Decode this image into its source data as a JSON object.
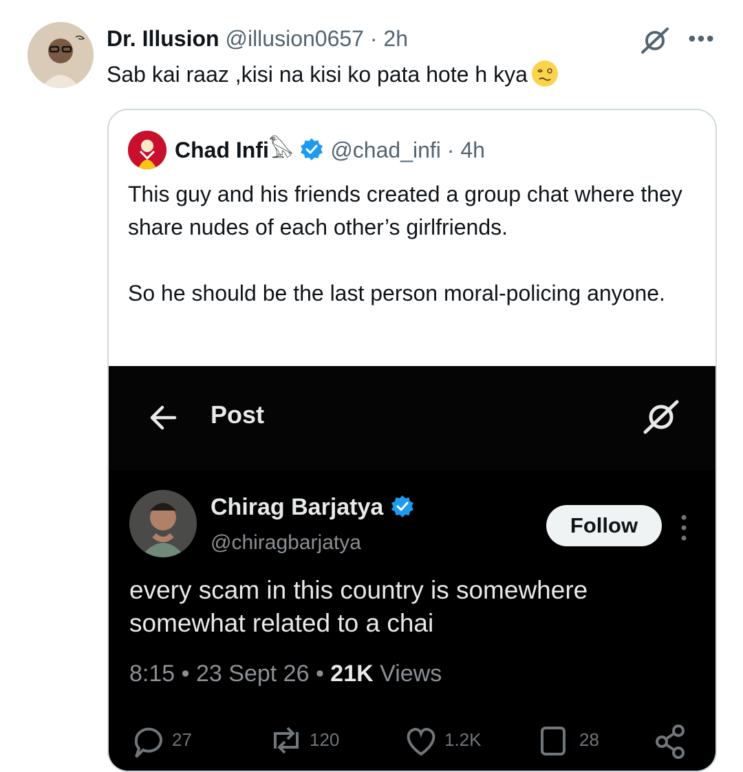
{
  "tweet": {
    "author_name": "Dr. Illusion",
    "handle": "@illusion0657",
    "separator": "·",
    "time": "2h",
    "text": "Sab kai raaz ,kisi na kisi ko pata hote h kya",
    "emoji_icon": "woozy-face-emoji",
    "more_label": "•••"
  },
  "quoted": {
    "author_name": "Chad Infi",
    "name_emoji": "𓅃",
    "handle": "@chad_infi",
    "separator": "·",
    "time": "4h",
    "verified": true,
    "text": "This guy and his friends created a group chat where they share nudes of each other’s girlfriends.\n\nSo he should be the last person moral-policing anyone."
  },
  "screenshot": {
    "page_title": "Post",
    "author_name": "Chirag Barjatya",
    "handle": "@chiragbarjatya",
    "follow_label": "Follow",
    "text": "every scam in this country is somewhere somewhat related to a chai",
    "time": "8:15",
    "date": "23 Sept 26",
    "views_count": "21K",
    "views_label": "Views",
    "dot": "•",
    "actions": {
      "replies": "27",
      "reposts": "120",
      "likes": "1.2K",
      "bookmarks": "28"
    }
  },
  "colors": {
    "text_primary": "#0f1419",
    "text_muted": "#536471",
    "verified_blue": "#1d9bf0",
    "card_border": "#cfd9de",
    "dark_bg": "#000000",
    "dark_text": "#e7e9ea",
    "dark_muted": "#8b8f94"
  }
}
